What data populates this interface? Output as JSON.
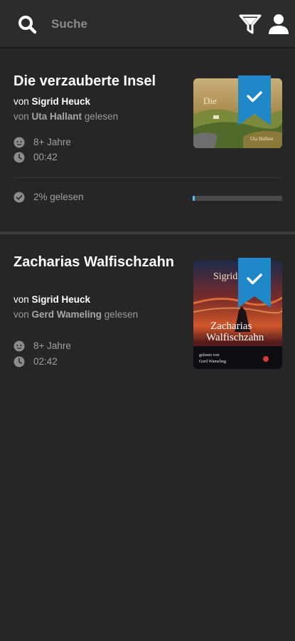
{
  "header": {
    "search_placeholder": "Suche",
    "icons": [
      "search-icon",
      "filter-icon",
      "user-icon"
    ]
  },
  "colors": {
    "background": "#262626",
    "header": "#2c2c2c",
    "accent": "#1e88c8",
    "progress": "#4fc3f7"
  },
  "books": [
    {
      "title": "Die verzauberte Insel",
      "author_prefix": "von ",
      "author": "Sigrid Heuck",
      "reader_prefix": "von ",
      "reader": "Uta Hallant",
      "reader_suffix": " gelesen",
      "age": "8+ Jahre",
      "duration": "00:42",
      "progress_text": "2% gelesen",
      "progress_fraction": 0.02,
      "bookmarked": true
    },
    {
      "title": "Zacharias Walfischzahn",
      "author_prefix": "von ",
      "author": "Sigrid Heuck",
      "reader_prefix": "von ",
      "reader": "Gerd Wameling",
      "reader_suffix": " gelesen",
      "age": "8+ Jahre",
      "duration": "02:42",
      "bookmarked": true
    }
  ]
}
